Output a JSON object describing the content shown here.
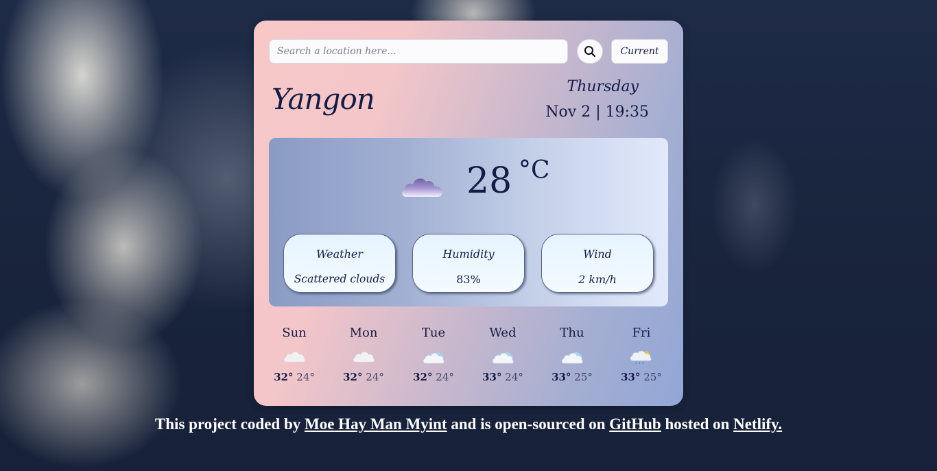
{
  "search": {
    "placeholder": "Search a location here...",
    "value": "",
    "search_button_icon": "magnifier-icon",
    "current_label": "Current"
  },
  "location": {
    "city": "Yangon",
    "day": "Thursday",
    "datetime": "Nov 2 | 19:35"
  },
  "current": {
    "icon": "cloud-icon",
    "temperature": "28",
    "unit": "°C",
    "details": [
      {
        "title": "Weather",
        "value": "Scattered clouds"
      },
      {
        "title": "Humidity",
        "value": "83%"
      },
      {
        "title": "Wind",
        "value": "2 km/h"
      }
    ]
  },
  "forecast": [
    {
      "day": "Sun",
      "icon": "cloud-icon",
      "max": "32°",
      "min": "24°"
    },
    {
      "day": "Mon",
      "icon": "cloud-icon",
      "max": "32°",
      "min": "24°"
    },
    {
      "day": "Tue",
      "icon": "blue-cloud-icon",
      "max": "32°",
      "min": "24°"
    },
    {
      "day": "Wed",
      "icon": "blue-cloud-icon",
      "max": "33°",
      "min": "24°"
    },
    {
      "day": "Thu",
      "icon": "blue-cloud-icon",
      "max": "33°",
      "min": "25°"
    },
    {
      "day": "Fri",
      "icon": "rain-sun-icon",
      "max": "33°",
      "min": "25°"
    }
  ],
  "footer": {
    "part1": "This project coded by ",
    "author": "Moe Hay Man Myint",
    "part2": " and is open-sourced on ",
    "github": "GitHub",
    "part3": " hosted on ",
    "netlify": "Netlify."
  },
  "colors": {
    "text_primary": "#141c45",
    "card_gradient_start": "#f8c8c8",
    "card_gradient_end": "#92a6d6"
  }
}
